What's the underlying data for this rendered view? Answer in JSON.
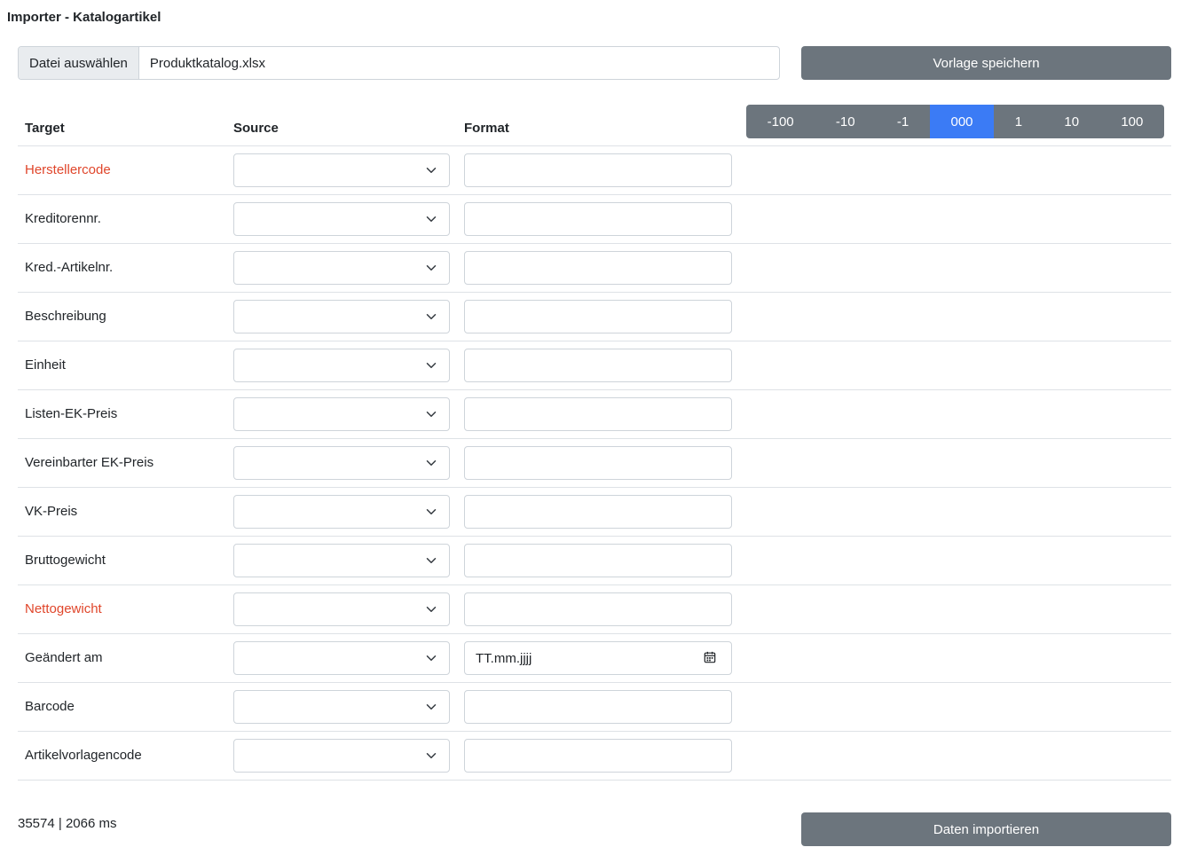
{
  "app": {
    "title": "Importer - Katalogartikel"
  },
  "file": {
    "button_label": "Datei auswählen",
    "file_name": "Produktkatalog.xlsx"
  },
  "toolbar": {
    "save_label": "Vorlage speichern",
    "import_label": "Daten importieren"
  },
  "stepper": {
    "items": [
      "-100",
      "-10",
      "-1",
      "000",
      "1",
      "10",
      "100"
    ],
    "active_index": 3,
    "accent_color": "#3b7bf5"
  },
  "table": {
    "headers": {
      "target": "Target",
      "source": "Source",
      "format": "Format"
    },
    "rows": [
      {
        "target": "Herstellercode",
        "required": true,
        "format_placeholder": ""
      },
      {
        "target": "Kreditorennr.",
        "required": false,
        "format_placeholder": ""
      },
      {
        "target": "Kred.-Artikelnr.",
        "required": false,
        "format_placeholder": ""
      },
      {
        "target": "Beschreibung",
        "required": false,
        "format_placeholder": ""
      },
      {
        "target": "Einheit",
        "required": false,
        "format_placeholder": ""
      },
      {
        "target": "Listen-EK-Preis",
        "required": false,
        "format_placeholder": ""
      },
      {
        "target": "Vereinbarter EK-Preis",
        "required": false,
        "format_placeholder": ""
      },
      {
        "target": "VK-Preis",
        "required": false,
        "format_placeholder": ""
      },
      {
        "target": "Bruttogewicht",
        "required": false,
        "format_placeholder": ""
      },
      {
        "target": "Nettogewicht",
        "required": true,
        "format_placeholder": ""
      },
      {
        "target": "Geändert am",
        "required": false,
        "format_placeholder": "TT.mm.jjjj",
        "date": true
      },
      {
        "target": "Barcode",
        "required": false,
        "format_placeholder": ""
      },
      {
        "target": "Artikelvorlagencode",
        "required": false,
        "format_placeholder": ""
      }
    ]
  },
  "status": {
    "text": "35574 | 2066 ms"
  },
  "icons": {
    "select_arrow": "chevron-down-icon",
    "date_picker": "calendar-icon"
  },
  "colors": {
    "required": "#e0462b",
    "button_gray": "#6c757d"
  }
}
